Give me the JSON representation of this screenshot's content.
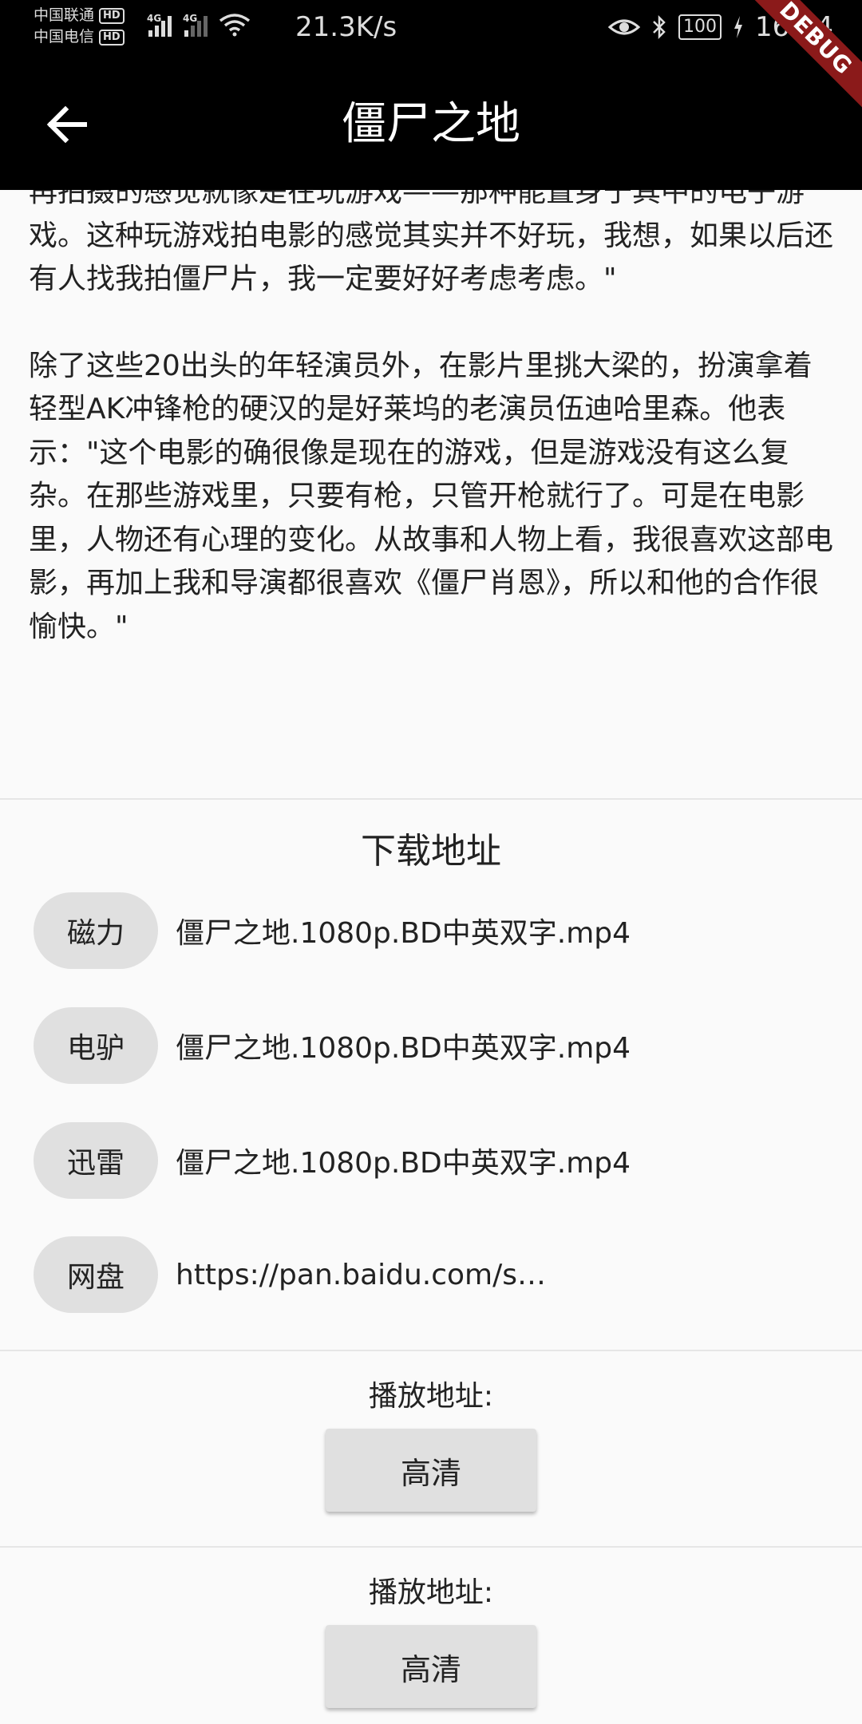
{
  "status_bar": {
    "carrier_1": "中国联通",
    "carrier_2": "中国电信",
    "hd_badge": "HD",
    "network_tag": "4G",
    "net_speed": "21.3K/s",
    "battery": "100",
    "time": "16:24"
  },
  "debug_ribbon": "DEBUG",
  "app_bar": {
    "title": "僵尸之地",
    "back_icon": "arrow-left-icon"
  },
  "article": {
    "paragraph_1": "再拍摄的感觉就像是在玩游戏——那种能置身于其中的电子游戏。这种玩游戏拍电影的感觉其实并不好玩，我想，如果以后还有人找我拍僵尸片，我一定要好好考虑考虑。\"",
    "paragraph_2": "除了这些20出头的年轻演员外，在影片里挑大梁的，扮演拿着轻型AK冲锋枪的硬汉的是好莱坞的老演员伍迪哈里森。他表示：\"这个电影的确很像是现在的游戏，但是游戏没有这么复杂。在那些游戏里，只要有枪，只管开枪就行了。可是在电影里，人物还有心理的变化。从故事和人物上看，我很喜欢这部电影，再加上我和导演都很喜欢《僵尸肖恩》，所以和他的合作很愉快。\""
  },
  "downloads": {
    "title": "下载地址",
    "items": [
      {
        "type": "磁力",
        "link": "僵尸之地.1080p.BD中英双字.mp4"
      },
      {
        "type": "电驴",
        "link": "僵尸之地.1080p.BD中英双字.mp4"
      },
      {
        "type": "迅雷",
        "link": "僵尸之地.1080p.BD中英双字.mp4"
      },
      {
        "type": "网盘",
        "link": "https://pan.baidu.com/s…"
      }
    ]
  },
  "play_sections": [
    {
      "label": "播放地址:",
      "button": "高清"
    },
    {
      "label": "播放地址:",
      "button": "高清"
    }
  ]
}
